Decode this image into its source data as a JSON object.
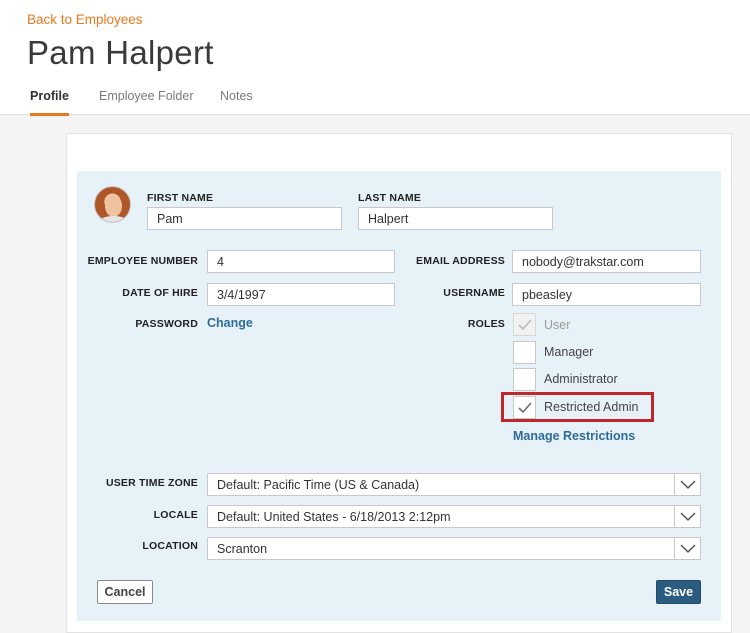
{
  "header": {
    "back_link": "Back to Employees",
    "title": "Pam Halpert",
    "tabs": [
      {
        "label": "Profile",
        "active": true
      },
      {
        "label": "Employee Folder",
        "active": false
      },
      {
        "label": "Notes",
        "active": false
      }
    ]
  },
  "form": {
    "first_name": {
      "label": "FIRST NAME",
      "value": "Pam"
    },
    "last_name": {
      "label": "LAST NAME",
      "value": "Halpert"
    },
    "employee_number": {
      "label": "EMPLOYEE NUMBER",
      "value": "4"
    },
    "date_of_hire": {
      "label": "DATE OF HIRE",
      "value": "3/4/1997"
    },
    "password": {
      "label": "PASSWORD",
      "link": "Change"
    },
    "email": {
      "label": "EMAIL ADDRESS",
      "value": "nobody@trakstar.com"
    },
    "username": {
      "label": "USERNAME",
      "value": "pbeasley"
    },
    "roles": {
      "label": "ROLES",
      "items": [
        {
          "label": "User",
          "checked": true,
          "disabled": true
        },
        {
          "label": "Manager",
          "checked": false,
          "disabled": false
        },
        {
          "label": "Administrator",
          "checked": false,
          "disabled": false
        },
        {
          "label": "Restricted Admin",
          "checked": true,
          "disabled": false,
          "highlighted": true
        }
      ],
      "manage_link": "Manage Restrictions"
    },
    "time_zone": {
      "label": "USER TIME ZONE",
      "value": "Default: Pacific Time (US & Canada)"
    },
    "locale": {
      "label": "LOCALE",
      "value": "Default: United States - 6/18/2013 2:12pm"
    },
    "location": {
      "label": "LOCATION",
      "value": "Scranton"
    }
  },
  "actions": {
    "cancel": "Cancel",
    "save": "Save"
  },
  "colors": {
    "accent": "#e8781e",
    "link": "#2e6b9a",
    "panel_bg": "#e7f2f8",
    "primary_button": "#2c5b80",
    "highlight_box": "#c0272d"
  }
}
